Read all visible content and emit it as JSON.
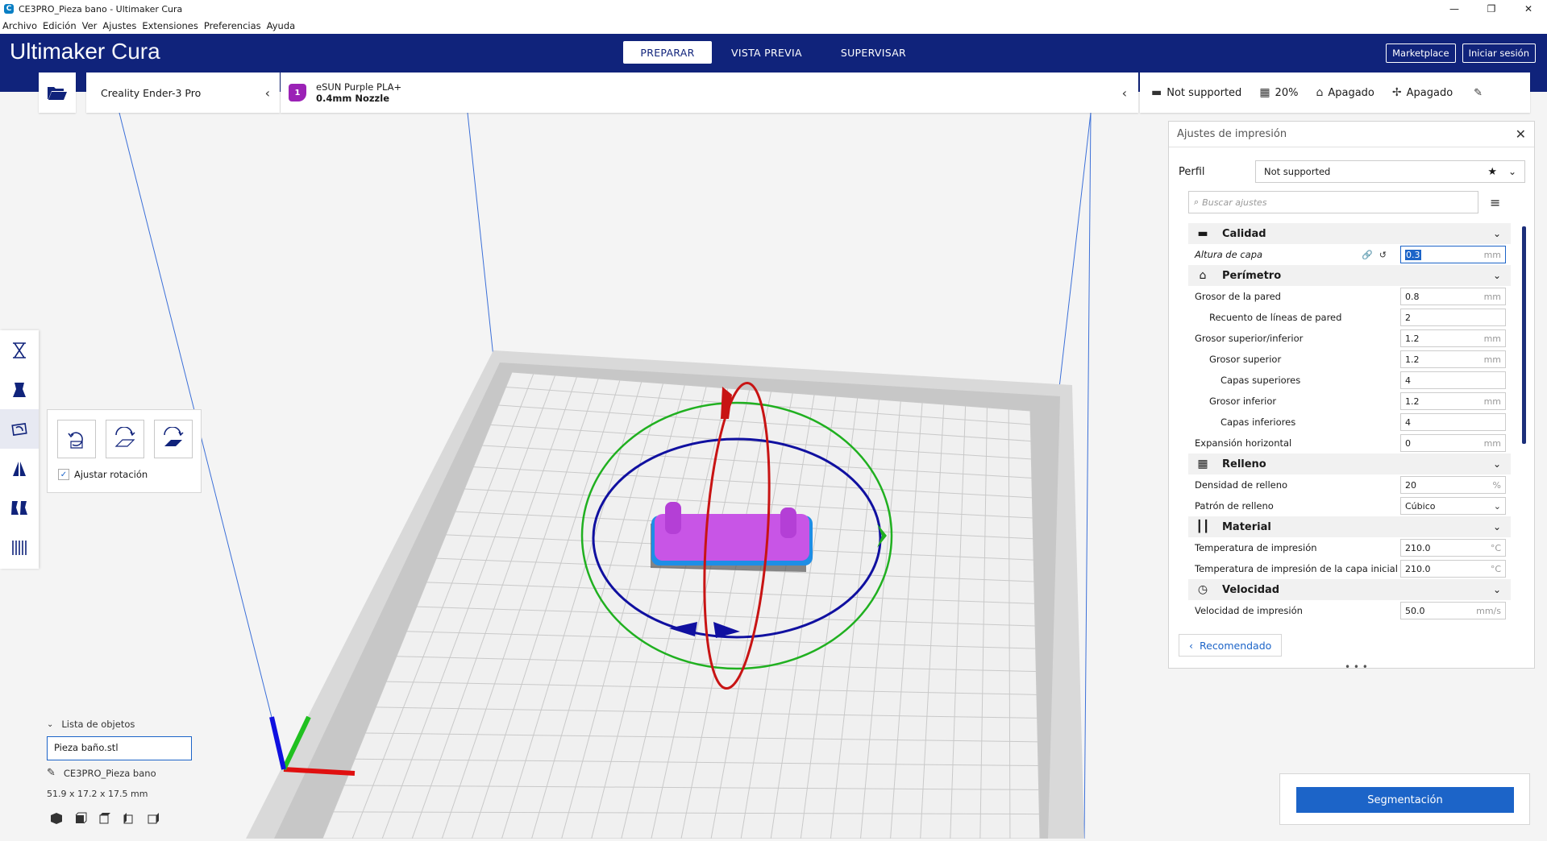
{
  "window": {
    "app_icon": "C",
    "title": "CE3PRO_Pieza bano - Ultimaker Cura",
    "controls": [
      "—",
      "❐",
      "✕"
    ]
  },
  "menu": [
    "Archivo",
    "Edición",
    "Ver",
    "Ajustes",
    "Extensiones",
    "Preferencias",
    "Ayuda"
  ],
  "header": {
    "brand_1": "Ultimaker",
    "brand_2": "Cura",
    "tabs": [
      "PREPARAR",
      "VISTA PREVIA",
      "SUPERVISAR"
    ],
    "active_tab": "PREPARAR",
    "marketplace": "Marketplace",
    "login": "Iniciar sesión"
  },
  "printer": {
    "name": "Creality Ender-3 Pro"
  },
  "material": {
    "extruder": "1",
    "name": "eSUN Purple PLA+",
    "nozzle": "0.4mm Nozzle",
    "color": "#9b22b6"
  },
  "summary": {
    "profile": "Not supported",
    "infill": "20%",
    "support": "Apagado",
    "adhesion": "Apagado"
  },
  "rotate_panel": {
    "snap_label": "Ajustar rotación",
    "snap_checked": true
  },
  "object_list": {
    "header": "Lista de objetos",
    "item": "Pieza baño.stl",
    "job_name": "CE3PRO_Pieza bano",
    "dimensions": "51.9 x 17.2 x 17.5 mm"
  },
  "settings": {
    "title": "Ajustes de impresión",
    "profile_label": "Perfil",
    "profile_value": "Not supported",
    "search_placeholder": "Buscar ajustes",
    "rows": [
      {
        "type": "cat",
        "icon": "▬",
        "label": "Calidad"
      },
      {
        "type": "set",
        "label": "Altura de capa",
        "value": "0.3",
        "unit": "mm",
        "indent": 0,
        "focus": true,
        "highlight": true
      },
      {
        "type": "cat",
        "icon": "⌂",
        "label": "Perímetro"
      },
      {
        "type": "set",
        "label": "Grosor de la pared",
        "value": "0.8",
        "unit": "mm",
        "indent": 0
      },
      {
        "type": "set",
        "label": "Recuento de líneas de pared",
        "value": "2",
        "unit": "",
        "indent": 1
      },
      {
        "type": "set",
        "label": "Grosor superior/inferior",
        "value": "1.2",
        "unit": "mm",
        "indent": 0
      },
      {
        "type": "set",
        "label": "Grosor superior",
        "value": "1.2",
        "unit": "mm",
        "indent": 1
      },
      {
        "type": "set",
        "label": "Capas superiores",
        "value": "4",
        "unit": "",
        "indent": 2
      },
      {
        "type": "set",
        "label": "Grosor inferior",
        "value": "1.2",
        "unit": "mm",
        "indent": 1
      },
      {
        "type": "set",
        "label": "Capas inferiores",
        "value": "4",
        "unit": "",
        "indent": 2
      },
      {
        "type": "set",
        "label": "Expansión horizontal",
        "value": "0",
        "unit": "mm",
        "indent": 0
      },
      {
        "type": "cat",
        "icon": "▦",
        "label": "Relleno"
      },
      {
        "type": "set",
        "label": "Densidad de relleno",
        "value": "20",
        "unit": "%",
        "indent": 0
      },
      {
        "type": "set",
        "label": "Patrón de relleno",
        "value": "Cúbico",
        "unit": "⌄",
        "indent": 0,
        "select": true
      },
      {
        "type": "cat",
        "icon": "┃┃",
        "label": "Material"
      },
      {
        "type": "set",
        "label": "Temperatura de impresión",
        "value": "210.0",
        "unit": "°C",
        "indent": 0
      },
      {
        "type": "set",
        "label": "Temperatura de impresión de la capa inicial",
        "value": "210.0",
        "unit": "°C",
        "indent": 0
      },
      {
        "type": "cat",
        "icon": "◷",
        "label": "Velocidad"
      },
      {
        "type": "set",
        "label": "Velocidad de impresión",
        "value": "50.0",
        "unit": "mm/s",
        "indent": 0
      }
    ],
    "recommended": "Recomendado"
  },
  "slice": {
    "button": "Segmentación"
  },
  "colors": {
    "header": "#10237b",
    "accent": "#1c64c8",
    "model": "#c855e6",
    "x_axis": "#e01010",
    "y_axis": "#20c020",
    "z_axis": "#1010e0"
  }
}
